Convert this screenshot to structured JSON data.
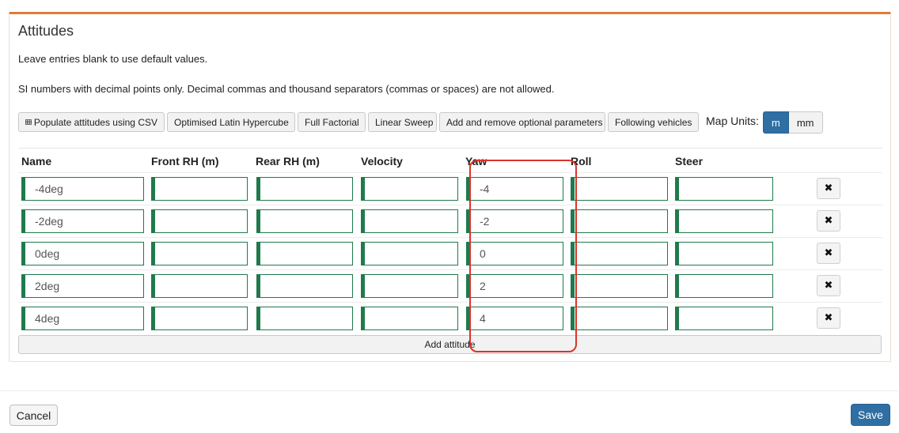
{
  "panel": {
    "title": "Attitudes",
    "help_line_1": "Leave entries blank to use default values.",
    "help_line_2": "SI numbers with decimal points only. Decimal commas and thousand separators (commas or spaces) are not allowed."
  },
  "toolbar": {
    "populate_csv": "Populate attitudes using CSV",
    "latin_hypercube": "Optimised Latin Hypercube",
    "full_factorial": "Full Factorial",
    "linear_sweep": "Linear Sweep",
    "optional_params": "Add and remove optional parameters",
    "following_vehicles": "Following vehicles",
    "populate_icon": "table-grid-icon"
  },
  "map_units": {
    "label": "Map Units:",
    "options": [
      "m",
      "mm"
    ],
    "selected": "m"
  },
  "table": {
    "headers": [
      "Name",
      "Front RH (m)",
      "Rear RH (m)",
      "Velocity",
      "Yaw",
      "Roll",
      "Steer"
    ],
    "rows": [
      {
        "name": "-4deg",
        "front_rh": "",
        "rear_rh": "",
        "velocity": "",
        "yaw": "-4",
        "roll": "",
        "steer": "",
        "delete_icon": "✖"
      },
      {
        "name": "-2deg",
        "front_rh": "",
        "rear_rh": "",
        "velocity": "",
        "yaw": "-2",
        "roll": "",
        "steer": "",
        "delete_icon": "✖"
      },
      {
        "name": "0deg",
        "front_rh": "",
        "rear_rh": "",
        "velocity": "",
        "yaw": "0",
        "roll": "",
        "steer": "",
        "delete_icon": "✖"
      },
      {
        "name": "2deg",
        "front_rh": "",
        "rear_rh": "",
        "velocity": "",
        "yaw": "2",
        "roll": "",
        "steer": "",
        "delete_icon": "✖"
      },
      {
        "name": "4deg",
        "front_rh": "",
        "rear_rh": "",
        "velocity": "",
        "yaw": "4",
        "roll": "",
        "steer": "",
        "delete_icon": "✖"
      }
    ],
    "add_label": "Add attitude"
  },
  "footer": {
    "cancel_label": "Cancel",
    "save_label": "Save"
  },
  "colors": {
    "accent_orange": "#e07b39",
    "input_green": "#1f7a4c",
    "primary_blue": "#2f6fa3",
    "highlight_red": "#d9342b"
  }
}
